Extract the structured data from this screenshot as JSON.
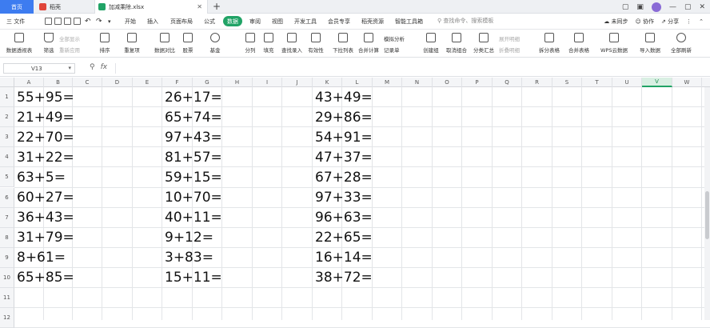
{
  "titlebar": {
    "tabs": [
      {
        "label": "首页"
      },
      {
        "label": "稻壳"
      },
      {
        "label": "加减乘除.xlsx"
      }
    ],
    "new_tab": "+",
    "controls": [
      "▢",
      "▣",
      "—",
      "▢",
      "✕"
    ]
  },
  "menubar": {
    "file_label": "三 文件",
    "items": [
      "开始",
      "插入",
      "页面布局",
      "公式",
      "数据",
      "审阅",
      "视图",
      "开发工具",
      "会员专享",
      "稻壳资源",
      "智能工具箱"
    ],
    "active_index": 4,
    "search_placeholder": "查找命令、搜索模板",
    "cloud_sync": "未同步",
    "collab": "协作",
    "share": "分享"
  },
  "ribbon": {
    "buttons": [
      "数据透视表",
      "筛选",
      "排序",
      "重复项",
      "数据对比",
      "股票",
      "基金",
      "分列",
      "填充",
      "查找录入",
      "有效性",
      "下拉列表",
      "合并计算",
      "创建组",
      "取消组合",
      "分类汇总",
      "拆分表格",
      "合并表格",
      "WPS云数据",
      "全部刷新"
    ],
    "small": {
      "show_all": "全部显示",
      "reapply": "重新应用",
      "simulate": "模拟分析",
      "record": "记录单",
      "expand": "展开明细",
      "collapse": "折叠明细"
    }
  },
  "formulabar": {
    "cell_ref": "V13",
    "fx": "fx",
    "zoom_icon": "⚲",
    "content": ""
  },
  "columns": [
    "A",
    "B",
    "C",
    "D",
    "E",
    "F",
    "G",
    "H",
    "I",
    "J",
    "K",
    "L",
    "M",
    "N",
    "O",
    "P",
    "Q",
    "R",
    "S",
    "T",
    "U",
    "V",
    "W"
  ],
  "selected_column": "V",
  "rows": [
    "1",
    "2",
    "3",
    "4",
    "5",
    "6",
    "7",
    "8",
    "9",
    "10",
    "11",
    "12"
  ],
  "sheet": {
    "colA": [
      "55+95=",
      "21+49=",
      "22+70=",
      "31+22=",
      "63+5=",
      "60+27=",
      "36+43=",
      "31+79=",
      "8+61=",
      "65+85="
    ],
    "colF": [
      "26+17=",
      "65+74=",
      "97+43=",
      "81+57=",
      "59+15=",
      "10+70=",
      "40+11=",
      "9+12=",
      "3+83=",
      "15+11="
    ],
    "colK": [
      "43+49=",
      "29+86=",
      "54+91=",
      "47+37=",
      "67+28=",
      "97+33=",
      "96+63=",
      "22+65=",
      "16+14=",
      "38+72="
    ]
  },
  "colors": {
    "accent": "#21a366",
    "home_tab": "#3d7cf0"
  }
}
